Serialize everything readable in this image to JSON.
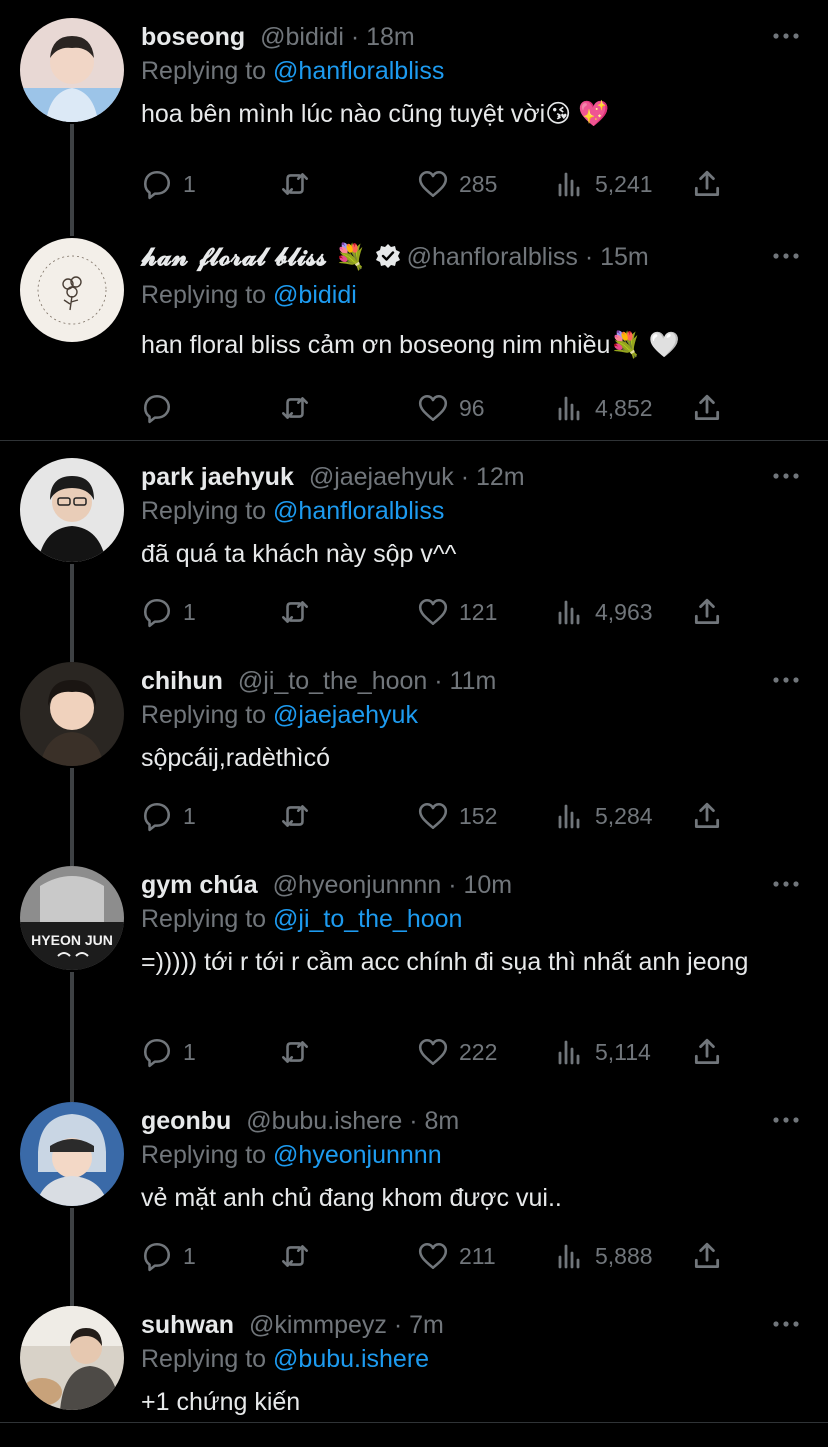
{
  "tweets": [
    {
      "name": "boseong",
      "handle": "@bididi",
      "time": "18m",
      "reply_prefix": "Replying to",
      "reply_to": "@hanfloralbliss",
      "text": "hoa bên mình lúc nào cũng tuyệt vời😘 💖",
      "replies": "1",
      "retweets": "",
      "likes": "285",
      "views": "5,241"
    },
    {
      "name": "𝓱𝓪𝓷 𝓯𝓵𝓸𝓻𝓪𝓵 𝓫𝓵𝓲𝓼𝓼 💐",
      "handle": "@hanfloralbliss",
      "time": "15m",
      "reply_prefix": "Replying to",
      "reply_to": "@bididi",
      "text": "han floral bliss cảm ơn boseong nim nhiều💐 🤍",
      "replies": "",
      "retweets": "",
      "likes": "96",
      "views": "4,852"
    },
    {
      "name": "park jaehyuk",
      "handle": "@jaejaehyuk",
      "time": "12m",
      "reply_prefix": "Replying to",
      "reply_to": "@hanfloralbliss",
      "text": "đã quá ta khách này sộp v^^",
      "replies": "1",
      "retweets": "",
      "likes": "121",
      "views": "4,963"
    },
    {
      "name": "chihun",
      "handle": "@ji_to_the_hoon",
      "time": "11m",
      "reply_prefix": "Replying to",
      "reply_to": "@jaejaehyuk",
      "text": "sộpcáij,radèthìcó",
      "replies": "1",
      "retweets": "",
      "likes": "152",
      "views": "5,284"
    },
    {
      "name": "gym chúa",
      "handle": "@hyeonjunnnn",
      "time": "10m",
      "reply_prefix": "Replying to",
      "reply_to": "@ji_to_the_hoon",
      "text": "=))))) tới r tới r cầm acc chính đi sụa thì nhất anh jeong",
      "replies": "1",
      "retweets": "",
      "likes": "222",
      "views": "5,114",
      "avatar_text": "HYEON JUN"
    },
    {
      "name": "geonbu",
      "handle": "@bubu.ishere",
      "time": "8m",
      "reply_prefix": "Replying to",
      "reply_to": "@hyeonjunnnn",
      "text": "vẻ mặt anh chủ đang khom được vui..",
      "replies": "1",
      "retweets": "",
      "likes": "211",
      "views": "5,888"
    },
    {
      "name": "suhwan",
      "handle": "@kimmpeyz",
      "time": "7m",
      "reply_prefix": "Replying to",
      "reply_to": "@bubu.ishere",
      "text": "+1 chứng kiến"
    }
  ],
  "icons": {
    "reply": "reply-icon",
    "retweet": "retweet-icon",
    "like": "heart-icon",
    "views": "views-icon",
    "share": "share-icon",
    "more": "more-icon",
    "verified": "verified-badge-icon"
  },
  "colors": {
    "background": "#000000",
    "text": "#e7e9ea",
    "muted": "#71767b",
    "accent": "#1d9bf0",
    "line": "#3e4144"
  }
}
